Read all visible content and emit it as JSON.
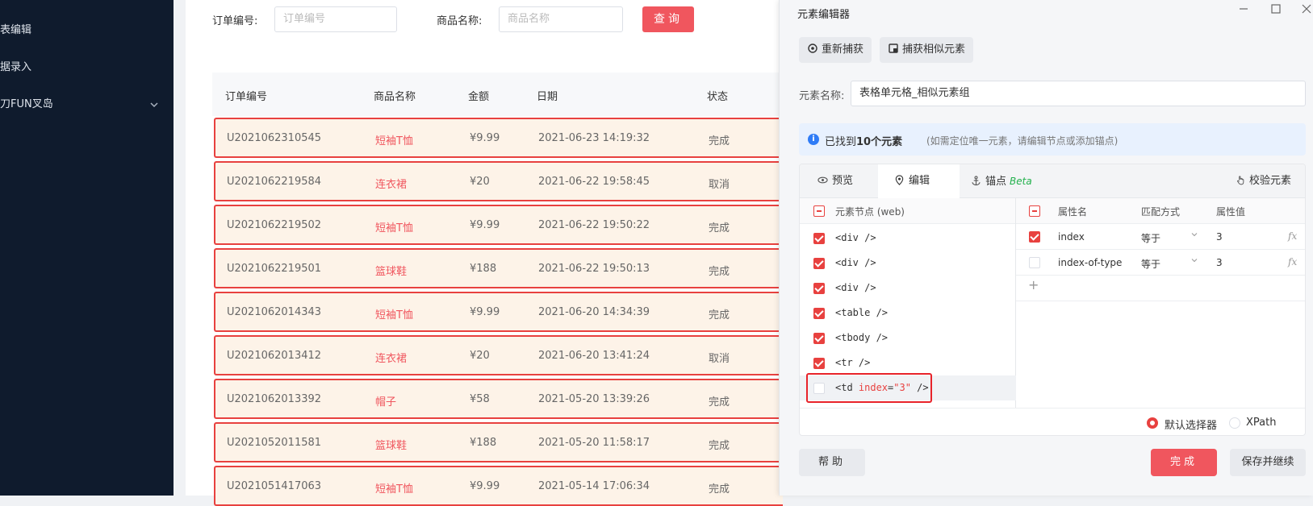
{
  "sidebar": {
    "items": [
      {
        "label": "表编辑"
      },
      {
        "label": "据录入"
      },
      {
        "label": "刀FUN叉岛"
      }
    ]
  },
  "filters": {
    "order_label": "订单编号:",
    "order_placeholder": "订单编号",
    "product_label": "商品名称:",
    "product_placeholder": "商品名称",
    "query_label": "查询"
  },
  "table": {
    "headers": [
      "订单编号",
      "商品名称",
      "金额",
      "日期",
      "状态"
    ],
    "rows": [
      {
        "order": "U2021062310545",
        "product": "短袖T恤",
        "amount": "¥9.99",
        "date": "2021-06-23 14:19:32",
        "status": "完成"
      },
      {
        "order": "U2021062219584",
        "product": "连衣裙",
        "amount": "¥20",
        "date": "2021-06-22 19:58:45",
        "status": "取消"
      },
      {
        "order": "U2021062219502",
        "product": "短袖T恤",
        "amount": "¥9.99",
        "date": "2021-06-22 19:50:22",
        "status": "完成"
      },
      {
        "order": "U2021062219501",
        "product": "篮球鞋",
        "amount": "¥188",
        "date": "2021-06-22 19:50:13",
        "status": "完成"
      },
      {
        "order": "U2021062014343",
        "product": "短袖T恤",
        "amount": "¥9.99",
        "date": "2021-06-20 14:34:39",
        "status": "完成"
      },
      {
        "order": "U2021062013412",
        "product": "连衣裙",
        "amount": "¥20",
        "date": "2021-06-20 13:41:24",
        "status": "取消"
      },
      {
        "order": "U2021062013392",
        "product": "帽子",
        "amount": "¥58",
        "date": "2021-05-20 13:39:26",
        "status": "完成"
      },
      {
        "order": "U2021052011581",
        "product": "篮球鞋",
        "amount": "¥188",
        "date": "2021-05-20 11:58:17",
        "status": "完成"
      },
      {
        "order": "U2021051417063",
        "product": "短袖T恤",
        "amount": "¥9.99",
        "date": "2021-05-14 17:06:34",
        "status": "完成"
      }
    ]
  },
  "dialog": {
    "title": "元素编辑器",
    "recapture_label": "重新捕获",
    "capture_similar_label": "捕获相似元素",
    "name_label": "元素名称:",
    "name_value": "表格单元格_相似元素组",
    "info_prefix": "已找到",
    "info_count": "10个元素",
    "info_hint": "(如需定位唯一元素，请编辑节点或添加锚点)",
    "tabs": {
      "preview": "预览",
      "edit": "编辑",
      "anchor": "锚点",
      "beta": "Beta",
      "verify": "校验元素"
    },
    "nodes_header": "元素节点 (web)",
    "nodes": [
      {
        "text": "<div />",
        "checked": true
      },
      {
        "text": "<div />",
        "checked": true
      },
      {
        "text": "<div />",
        "checked": true
      },
      {
        "text": "<table />",
        "checked": true
      },
      {
        "text": "<tbody />",
        "checked": true
      },
      {
        "text": "<tr />",
        "checked": true
      }
    ],
    "selected_node": {
      "tag": "<td ",
      "attr": "index",
      "eq": "=",
      "value": "\"3\"",
      "close": " />"
    },
    "attr_headers": {
      "name": "属性名",
      "match": "匹配方式",
      "value": "属性值"
    },
    "attrs": [
      {
        "name": "index",
        "match": "等于",
        "value": "3",
        "checked": true
      },
      {
        "name": "index-of-type",
        "match": "等于",
        "value": "3",
        "checked": false
      }
    ],
    "fx_label": "fx",
    "plus_label": "+",
    "radio_default": "默认选择器",
    "radio_xpath": "XPath",
    "help_label": "帮助",
    "done_label": "完成",
    "save_continue_label": "保存并继续"
  },
  "colors": {
    "accent": "#f0565e",
    "sidebar_bg": "#0f1b2d",
    "row_bg": "#fdf3e8",
    "info_bg": "#e8f1fe"
  }
}
